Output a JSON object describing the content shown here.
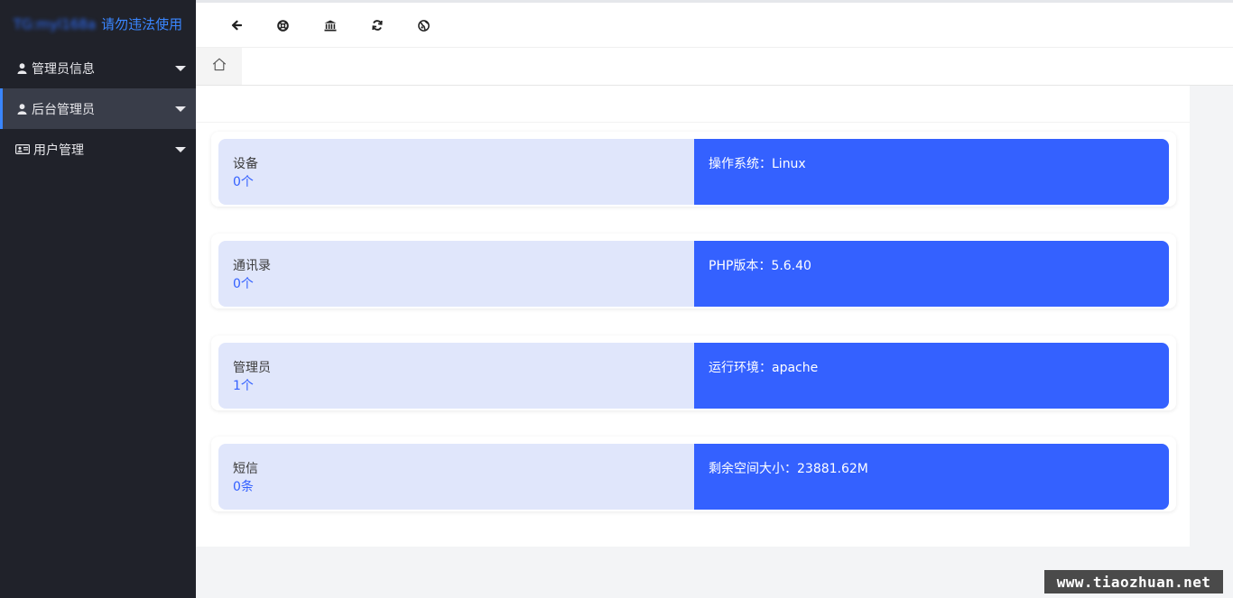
{
  "brand": {
    "blurred_name": "TG:myl168a",
    "notice": "请勿违法使用"
  },
  "sidebar": {
    "items": [
      {
        "label": "管理员信息",
        "icon": "user-icon",
        "active": false
      },
      {
        "label": "后台管理员",
        "icon": "user-icon",
        "active": true
      },
      {
        "label": "用户管理",
        "icon": "id-card-icon",
        "active": false
      }
    ]
  },
  "toolbar": {
    "icons": [
      "back-arrow-icon",
      "lifebuoy-icon",
      "bank-icon",
      "refresh-icon",
      "globe-icon"
    ]
  },
  "tabs": {
    "home_icon": "home-icon"
  },
  "stats": [
    {
      "label": "设备",
      "value": "0个",
      "info": "操作系统：Linux"
    },
    {
      "label": "通讯录",
      "value": "0个",
      "info": "PHP版本：5.6.40"
    },
    {
      "label": "管理员",
      "value": "1个",
      "info": "运行环境：apache"
    },
    {
      "label": "短信",
      "value": "0条",
      "info": "剩余空间大小：23881.62M"
    }
  ],
  "watermark": "www.tiaozhuan.net",
  "colors": {
    "sidebar_bg": "#20222a",
    "sidebar_active_bg": "#393d49",
    "accent": "#3461ff",
    "card_left_bg": "#e0e6fb"
  }
}
